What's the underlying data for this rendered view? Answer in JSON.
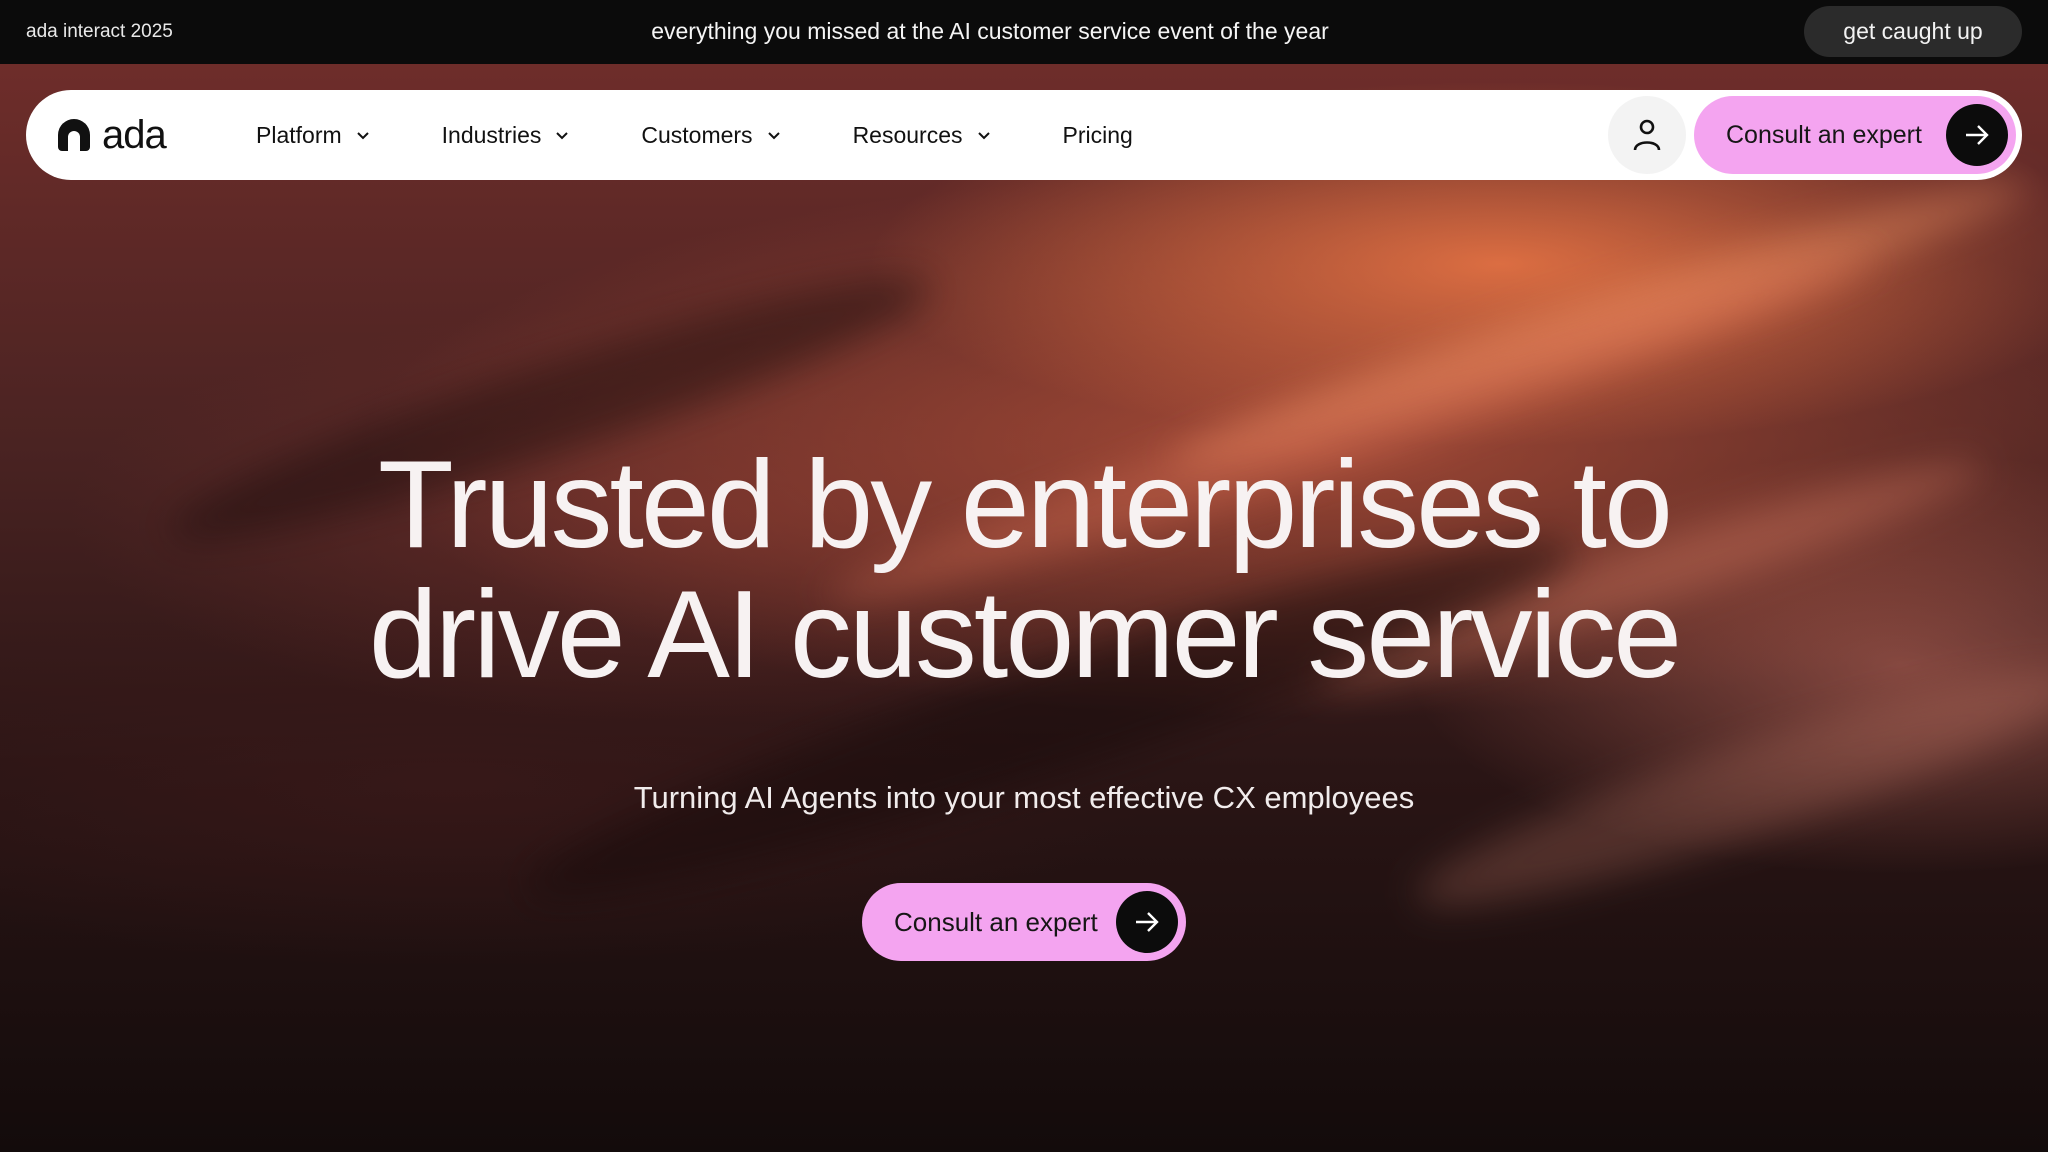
{
  "announcement": {
    "event_label": "ada interact 2025",
    "message": "everything you missed at the AI customer service event of the year",
    "button_label": "get caught up"
  },
  "nav": {
    "logo_text": "ada",
    "items": [
      {
        "label": "Platform",
        "has_dropdown": true
      },
      {
        "label": "Industries",
        "has_dropdown": true
      },
      {
        "label": "Customers",
        "has_dropdown": true
      },
      {
        "label": "Resources",
        "has_dropdown": true
      },
      {
        "label": "Pricing",
        "has_dropdown": false
      }
    ],
    "account_icon": "user-icon",
    "cta_label": "Consult an expert"
  },
  "hero": {
    "headline_line1": "Trusted by enterprises to",
    "headline_line2": "drive AI customer service",
    "subheadline": "Turning AI Agents into your most effective CX employees",
    "cta_label": "Consult an expert"
  },
  "colors": {
    "accent_pink": "#f4a4f0",
    "announcement_bg": "#0b0b0b",
    "nav_bg": "#ffffff",
    "hero_warm": "#d9683f"
  }
}
